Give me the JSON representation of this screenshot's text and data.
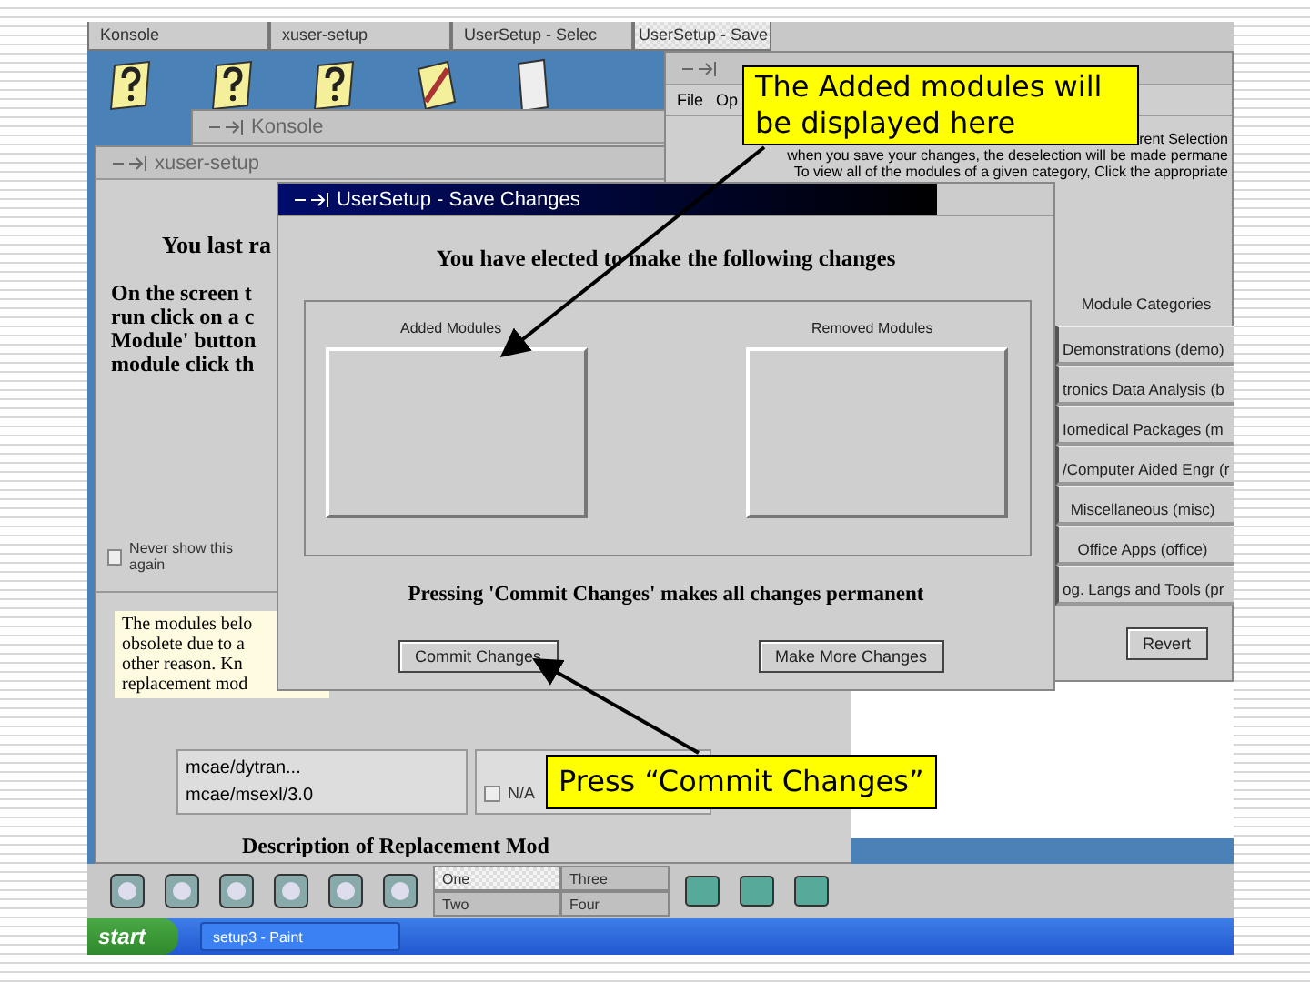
{
  "top_tabs": [
    {
      "label": "Konsole",
      "selected": false
    },
    {
      "label": "xuser-setup",
      "selected": false
    },
    {
      "label": "UserSetup - Selec",
      "selected": false
    },
    {
      "label": "UserSetup - Save",
      "selected": true
    }
  ],
  "konsole_window": {
    "title": "Konsole"
  },
  "xuser_setup_window": {
    "title": "xuser-setup",
    "heading": "You last ra",
    "paragraph": [
      "On the screen t",
      "run click on a c",
      "Module' button",
      "module click th"
    ],
    "never_show": {
      "label": "Never show this again",
      "checked": false
    },
    "notice": [
      "The modules belo",
      "obsolete due to a",
      "other reason. Kn",
      "replacement mod"
    ],
    "modules": [
      "mcae/dytran...",
      "mcae/msexl/3.0"
    ],
    "na_option": {
      "label": "N/A",
      "checked": false
    },
    "description_heading": "Description of Replacement Mod"
  },
  "selection_window": {
    "menu": [
      "File",
      "Op"
    ],
    "info": [
      "rent Selection",
      "when you save your changes, the deselection will be made permane",
      "To view all of the modules of a given category, Click the appropriate"
    ],
    "categories_header": "Module Categories",
    "categories": [
      "Demonstrations (demo)",
      "tronics Data Analysis (b",
      "Iomedical Packages (m",
      "/Computer Aided Engr (r",
      "Miscellaneous (misc)",
      "Office Apps (office)",
      "og. Langs and Tools (pr"
    ],
    "revert_button": "Revert"
  },
  "save_dialog": {
    "title": "UserSetup - Save Changes",
    "heading": "You have elected to make the following changes",
    "added_label": "Added Modules",
    "removed_label": "Removed Modules",
    "note": "Pressing 'Commit Changes' makes all changes permanent",
    "buttons": [
      "Commit Changes",
      "Make More Changes"
    ]
  },
  "pager": [
    {
      "label": "One",
      "selected": true
    },
    {
      "label": "Three",
      "selected": false
    },
    {
      "label": "Two",
      "selected": false
    },
    {
      "label": "Four",
      "selected": false
    }
  ],
  "taskbar": {
    "start": "start",
    "task": "setup3 - Paint"
  },
  "callouts": [
    "The Added modules will be displayed here",
    "Press “Commit Changes”"
  ]
}
